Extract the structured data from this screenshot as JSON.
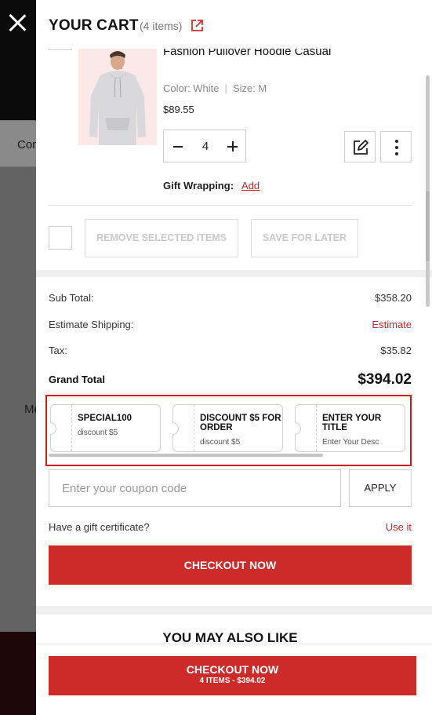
{
  "background": {
    "nav_text": "Con",
    "mid_text": "Me"
  },
  "cart": {
    "title": "YOUR CART",
    "count": "(4 items)"
  },
  "product": {
    "name": "Fashion Pullover Hoodie Casual",
    "color_label": "Color: White",
    "size_label": "Size: M",
    "price": "$89.55",
    "quantity": "4",
    "gift_label": "Gift Wrapping:",
    "gift_action": "Add"
  },
  "actions": {
    "remove_selected": "REMOVE SELECTED ITEMS",
    "save_for_later": "SAVE FOR LATER"
  },
  "summary": {
    "subtotal_label": "Sub Total:",
    "subtotal_value": "$358.20",
    "shipping_label": "Estimate Shipping:",
    "shipping_value": "Estimate",
    "tax_label": "Tax:",
    "tax_value": "$35.82",
    "grand_label": "Grand Total",
    "grand_value": "$394.02"
  },
  "coupons": [
    {
      "title": "SPECIAL100",
      "desc": "discount $5"
    },
    {
      "title": "DISCOUNT $5 FOR ORDER",
      "desc": "discount $5"
    },
    {
      "title": "ENTER YOUR TITLE",
      "desc": "Enter Your Desc"
    }
  ],
  "coupon_input": {
    "placeholder": "Enter your coupon code",
    "apply": "APPLY"
  },
  "gift_certificate": {
    "label": "Have a gift certificate?",
    "action": "Use it"
  },
  "checkout": {
    "label": "CHECKOUT NOW"
  },
  "also_like": "YOU MAY ALSO LIKE",
  "sticky_checkout": {
    "label": "CHECKOUT NOW",
    "sub": "4 ITEMS - $394.02"
  },
  "colors": {
    "accent": "#cd2a2a",
    "link": "#c62828",
    "highlight_border": "#d11a1a"
  }
}
